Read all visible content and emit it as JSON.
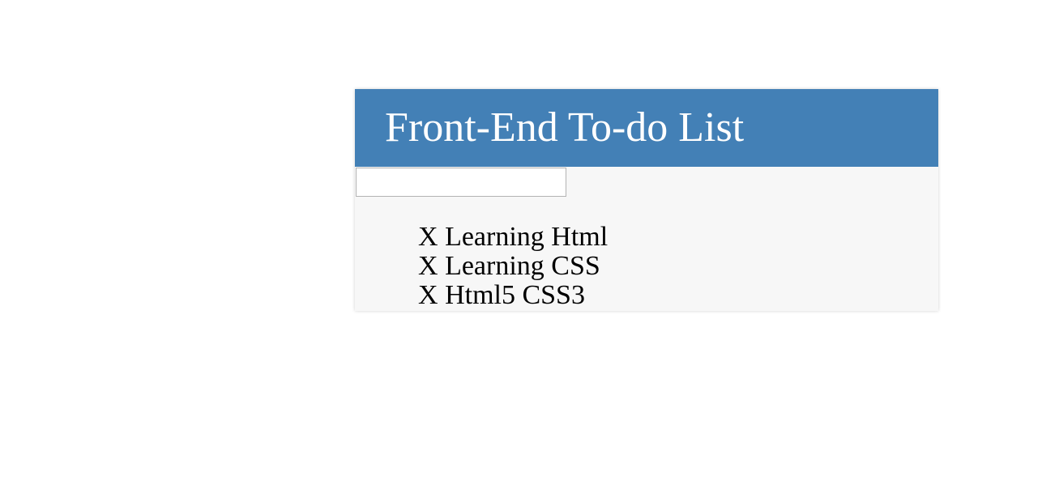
{
  "header": {
    "title": "Front-End To-do List"
  },
  "new_todo": {
    "value": "",
    "placeholder": ""
  },
  "todos": [
    {
      "delete_label": "X",
      "text": "Learning Html"
    },
    {
      "delete_label": "X",
      "text": "Learning CSS"
    },
    {
      "delete_label": "X",
      "text": "Html5 CSS3"
    }
  ],
  "colors": {
    "header_background": "#4380b6",
    "card_background": "#f7f7f7",
    "title_text": "#ffffff",
    "item_text": "#000000"
  }
}
